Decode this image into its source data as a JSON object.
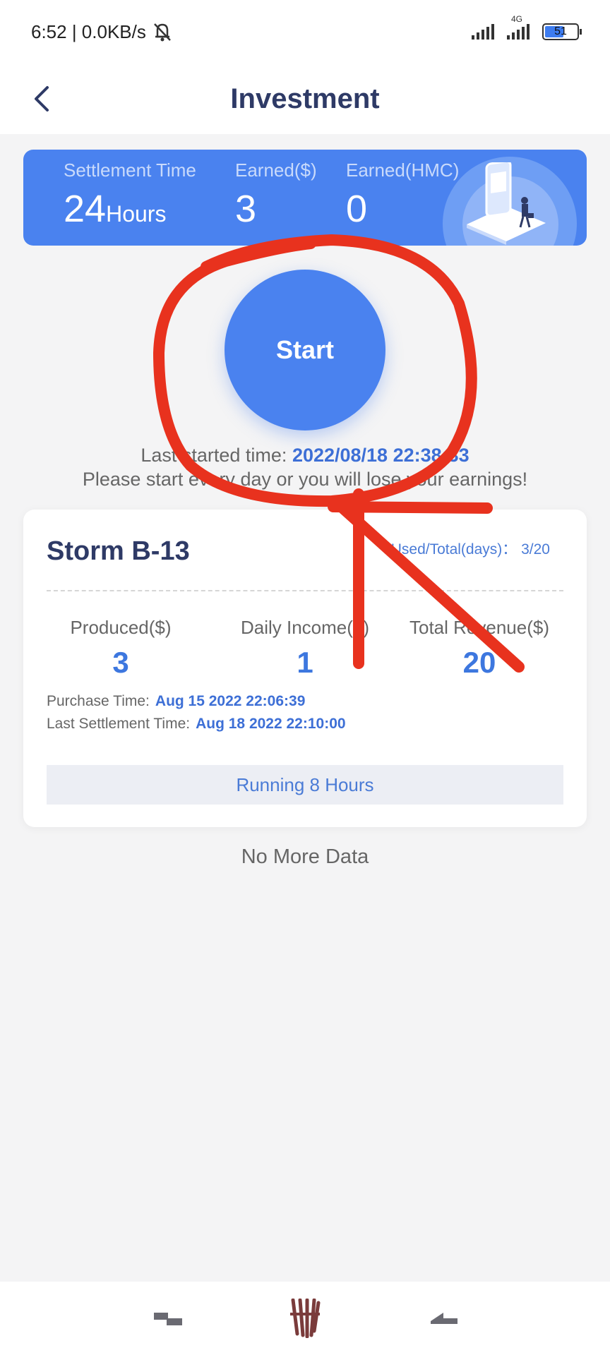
{
  "status_bar": {
    "time_speed": "6:52 | 0.0KB/s",
    "network": "4G",
    "battery": "51",
    "icons": [
      "mute-bell-icon",
      "signal-icon",
      "4g-signal-icon",
      "battery-icon"
    ]
  },
  "header": {
    "title": "Investment",
    "back_icon": "chevron-left-icon"
  },
  "summary": {
    "settlement_label": "Settlement Time",
    "settlement_value": "24",
    "settlement_unit": "Hours",
    "earned_usd_label": "Earned($)",
    "earned_usd_value": "3",
    "earned_hmc_label": "Earned(HMC)",
    "earned_hmc_value": "0"
  },
  "start": {
    "label": "Start",
    "last_started_label": "Last started time:",
    "last_started_value": "2022/08/18 22:38:33",
    "warning": "Please start every day or you will lose your earnings!"
  },
  "product": {
    "name": "Storm B-13",
    "days_label": "Used/Total(days)： 3/20",
    "produced_label": "Produced($)",
    "produced_value": "3",
    "daily_income_label": "Daily Income($)",
    "daily_income_value": "1",
    "total_revenue_label": "Total Revenue($)",
    "total_revenue_value": "20",
    "purchase_time_label": "Purchase Time:",
    "purchase_time_value": "Aug 15 2022 22:06:39",
    "settlement_time_label": "Last Settlement Time:",
    "settlement_time_value": "Aug 18 2022 22:10:00",
    "running_label": "Running 8 Hours"
  },
  "footer": {
    "no_more": "No More Data"
  },
  "system_nav": {
    "icons": [
      "recent-apps-icon",
      "home-logo-icon",
      "back-icon"
    ]
  },
  "colors": {
    "accent": "#4a82ef",
    "title": "#2e3a66",
    "annotation": "#e8321e"
  }
}
